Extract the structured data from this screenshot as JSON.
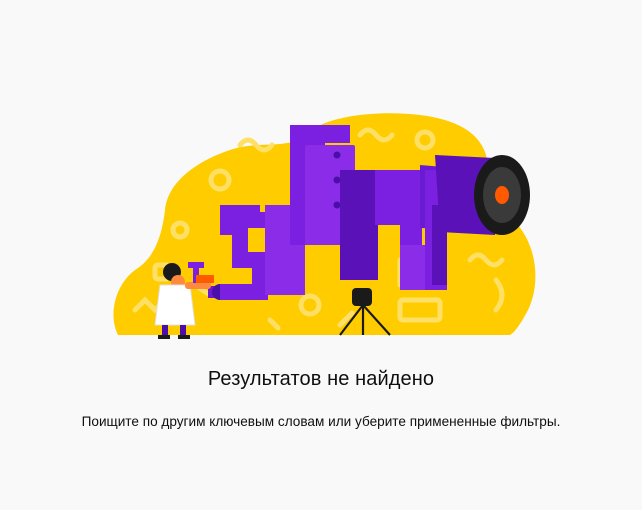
{
  "empty_state": {
    "title": "Результатов не найдено",
    "message": "Поищите по другим ключевым словам или уберите примененные фильтры."
  },
  "colors": {
    "background": "#f9f9f9",
    "blob_yellow": "#ffcc00",
    "blob_pattern": "#ffe066",
    "telescope_purple": "#7b1fe0",
    "telescope_dark_purple": "#4a0fa8",
    "lens_orange": "#ff5a00",
    "text": "#0f0f0f"
  }
}
